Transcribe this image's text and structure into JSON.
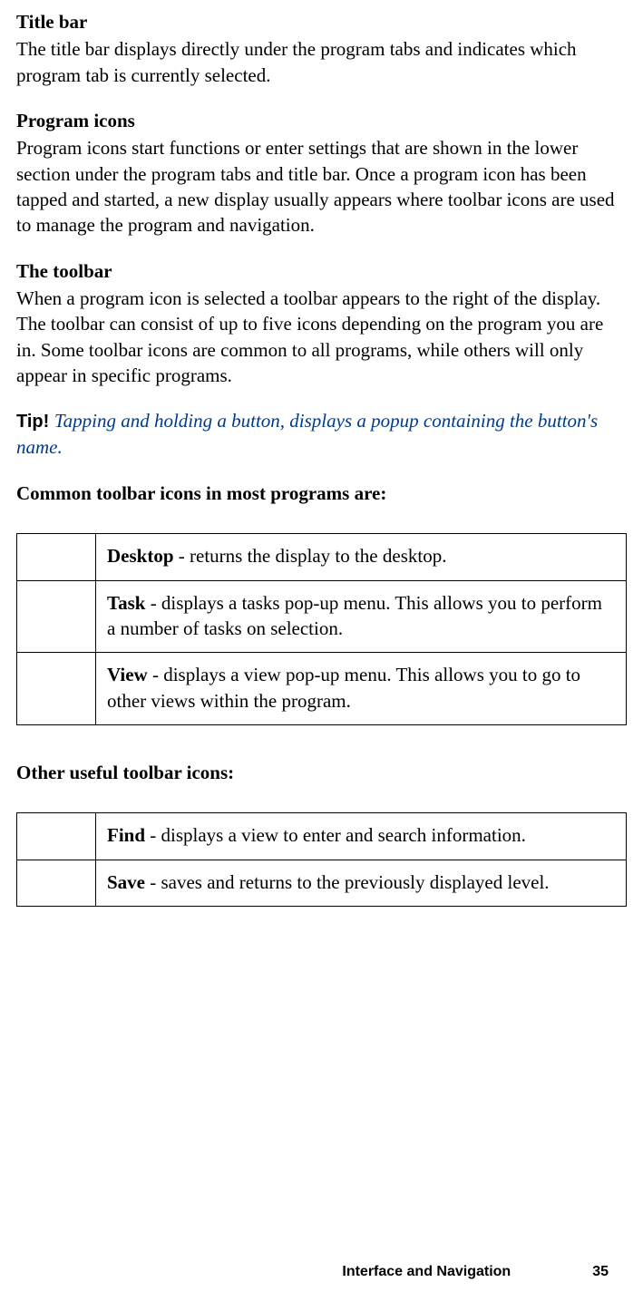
{
  "sections": {
    "titleBar": {
      "heading": "Title bar",
      "body": "The title bar displays directly under the program tabs and indicates which program tab is currently selected."
    },
    "programIcons": {
      "heading": "Program icons",
      "body": "Program icons start functions or enter settings that are shown in the lower section under the program tabs and title bar. Once a program icon has been tapped and started, a new display usually appears where toolbar icons are used to manage the program and navigation."
    },
    "toolbar": {
      "heading": "The toolbar",
      "body": "When a program icon is selected a toolbar appears to the right of the display. The toolbar can consist of up to five icons depending on the program you are in. Some toolbar icons are common to all programs, while others will only appear in specific programs."
    }
  },
  "tip": {
    "label": "Tip! ",
    "text": "Tapping and holding a button, displays a popup containing the button's name."
  },
  "commonIconsHeading": "Common toolbar icons in most programs are:",
  "commonIcons": [
    {
      "term": "Desktop",
      "desc": " - returns the display to the desktop."
    },
    {
      "term": "Task",
      "desc": " - displays a tasks pop-up menu. This allows you to perform a number of tasks on selection."
    },
    {
      "term": "View",
      "desc": " - displays a view pop-up menu. This allows you to go to other views within the program."
    }
  ],
  "otherIconsHeading": "Other useful toolbar icons:",
  "otherIcons": [
    {
      "term": "Find",
      "desc": " - displays a view to enter and search information."
    },
    {
      "term": "Save",
      "desc": " - saves and returns to the previously displayed level."
    }
  ],
  "footer": {
    "title": "Interface and Navigation",
    "page": "35"
  }
}
